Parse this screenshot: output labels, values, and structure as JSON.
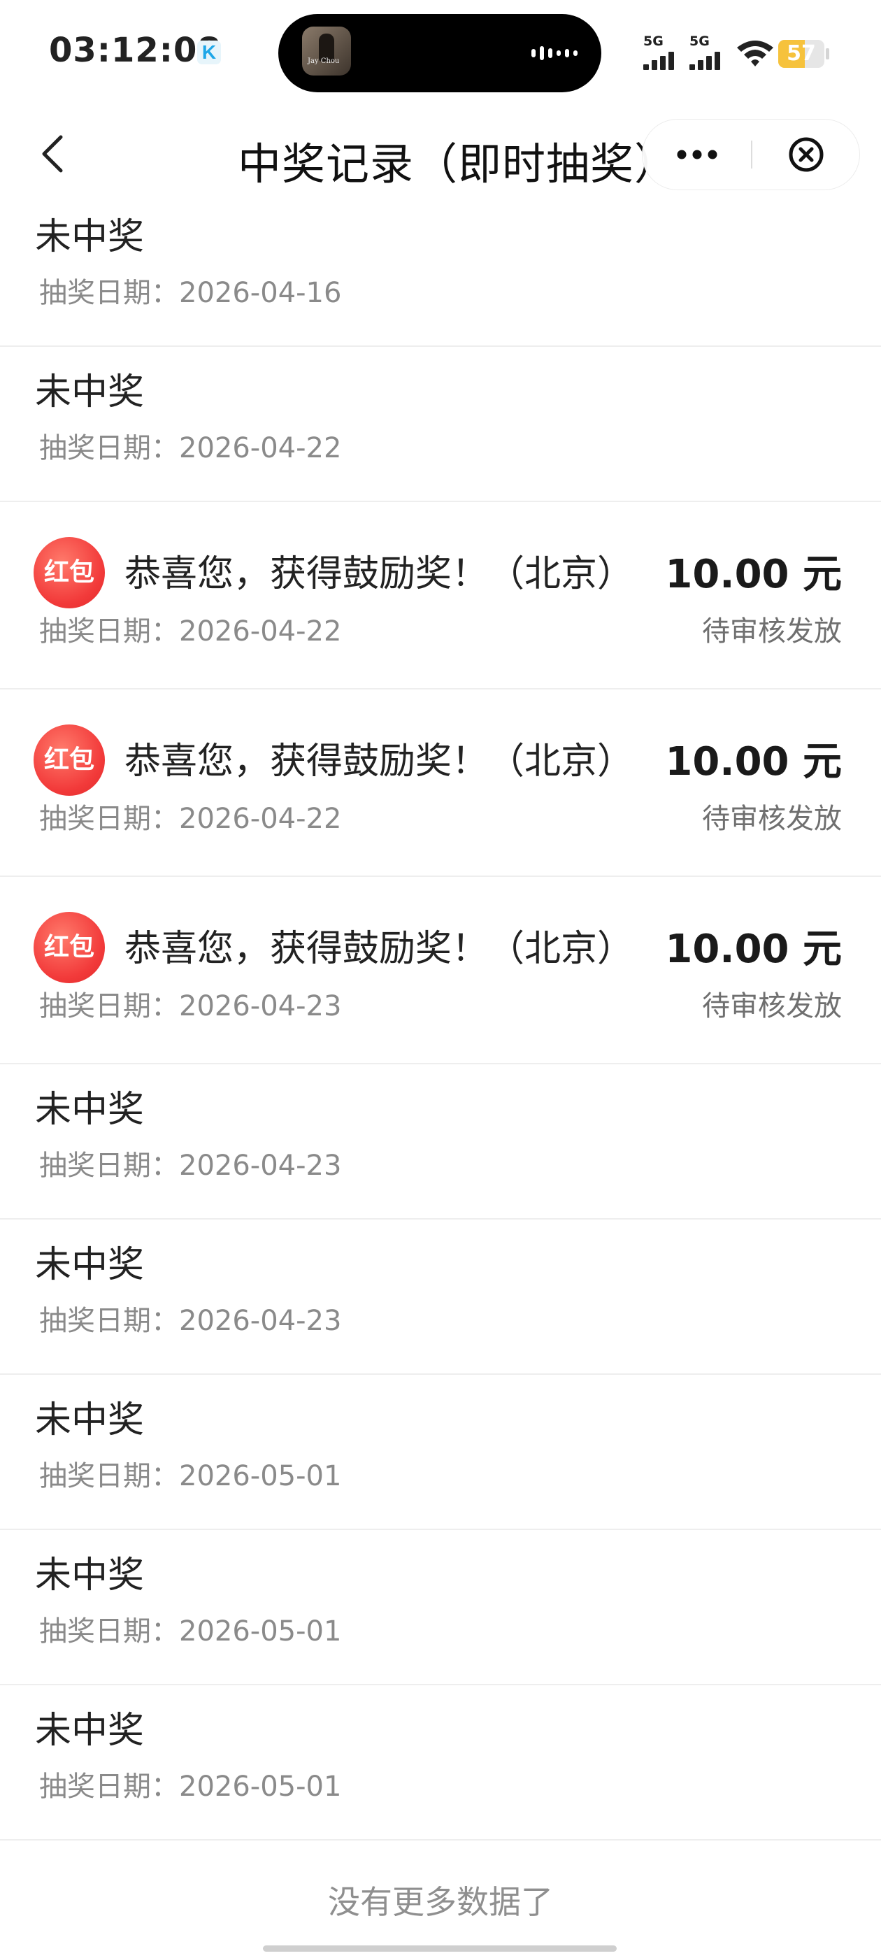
{
  "status_bar": {
    "time": "03:12:08",
    "app_badge": "K",
    "island_art_text": "Jay Chou",
    "sim1": "5G",
    "sim2": "5G",
    "battery_percent": 57
  },
  "nav": {
    "title": "中奖记录（即时抽奖）",
    "back_icon": "chevron-left-icon",
    "more_icon": "more-dots-icon",
    "close_icon": "circle-close-icon"
  },
  "records": [
    {
      "type": "miss",
      "title": "未中奖",
      "date": "抽奖日期：2026-04-16"
    },
    {
      "type": "miss",
      "title": "未中奖",
      "date": "抽奖日期：2026-04-22"
    },
    {
      "type": "win",
      "badge": "红包",
      "title": "恭喜您，获得鼓励奖！（北京）",
      "amount": "10.00 元",
      "date": "抽奖日期：2026-04-22",
      "status": "待审核发放"
    },
    {
      "type": "win",
      "badge": "红包",
      "title": "恭喜您，获得鼓励奖！（北京）",
      "amount": "10.00 元",
      "date": "抽奖日期：2026-04-22",
      "status": "待审核发放"
    },
    {
      "type": "win",
      "badge": "红包",
      "title": "恭喜您，获得鼓励奖！（北京）",
      "amount": "10.00 元",
      "date": "抽奖日期：2026-04-23",
      "status": "待审核发放"
    },
    {
      "type": "miss",
      "title": "未中奖",
      "date": "抽奖日期：2026-04-23"
    },
    {
      "type": "miss",
      "title": "未中奖",
      "date": "抽奖日期：2026-04-23"
    },
    {
      "type": "miss",
      "title": "未中奖",
      "date": "抽奖日期：2026-05-01"
    },
    {
      "type": "miss",
      "title": "未中奖",
      "date": "抽奖日期：2026-05-01"
    },
    {
      "type": "miss",
      "title": "未中奖",
      "date": "抽奖日期：2026-05-01"
    }
  ],
  "footer": "没有更多数据了",
  "colors": {
    "badge_red": "#f23a3a",
    "battery_yellow": "#f6c23c",
    "muted_text": "#8a8a8a"
  }
}
